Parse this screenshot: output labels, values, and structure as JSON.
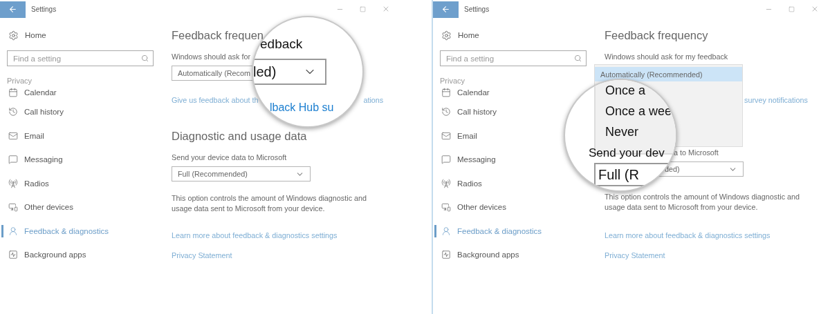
{
  "panels": [
    {
      "kind": "closed",
      "title": "Settings",
      "home": "Home",
      "search": {
        "placeholder": "Find a setting"
      },
      "section": "Privacy",
      "items": [
        {
          "label": "Calendar",
          "selected": false
        },
        {
          "label": "Call history",
          "selected": false
        },
        {
          "label": "Email",
          "selected": false
        },
        {
          "label": "Messaging",
          "selected": false
        },
        {
          "label": "Radios",
          "selected": false
        },
        {
          "label": "Other devices",
          "selected": false
        },
        {
          "label": "Feedback & diagnostics",
          "selected": true
        },
        {
          "label": "Background apps",
          "selected": false
        }
      ],
      "content": {
        "heading1": "Feedback frequen",
        "label1": "Windows should ask for",
        "dropdown1": "Automatically (Recom",
        "link1": [
          "Give us feedback about th",
          "ations"
        ],
        "heading2": "Diagnostic and usage data",
        "label2": "Send your device data to Microsoft",
        "dropdown2": "Full (Recommended)",
        "paragraph": "This option controls the amount of Windows diagnostic and usage data sent to Microsoft from your device.",
        "links": [
          "Learn more about feedback & diagnostics settings",
          "Privacy Statement"
        ]
      },
      "magnifier": {
        "heading": "edback",
        "dropdown": "led)",
        "link": "lback Hub su"
      }
    },
    {
      "kind": "open",
      "title": "Settings",
      "home": "Home",
      "search": {
        "placeholder": "Find a setting"
      },
      "section": "Privacy",
      "items": [
        {
          "label": "Calendar",
          "selected": false
        },
        {
          "label": "Call history",
          "selected": false
        },
        {
          "label": "Email",
          "selected": false
        },
        {
          "label": "Messaging",
          "selected": false
        },
        {
          "label": "Radios",
          "selected": false
        },
        {
          "label": "Other devices",
          "selected": false
        },
        {
          "label": "Feedback & diagnostics",
          "selected": true
        },
        {
          "label": "Background apps",
          "selected": false
        }
      ],
      "content": {
        "heading1": "Feedback frequency",
        "label1": "Windows should ask for my feedback",
        "list": [
          {
            "label": "Automatically (Recommended)",
            "selected": true
          }
        ],
        "link1": [
          "survey notifications"
        ],
        "label2": "a to Microsoft",
        "dropdown2": "ded)",
        "paragraph": "This option controls the amount of Windows diagnostic and usage data sent to Microsoft from your device.",
        "links": [
          "Learn more about feedback & diagnostics settings",
          "Privacy Statement"
        ]
      },
      "magnifier": {
        "options": [
          {
            "label": "Once a",
            "selected": false
          },
          {
            "label": "Once a wee",
            "selected": false
          },
          {
            "label": "Never",
            "selected": false
          }
        ],
        "label": "Send your dev",
        "dropdown": "Full (R"
      }
    }
  ]
}
